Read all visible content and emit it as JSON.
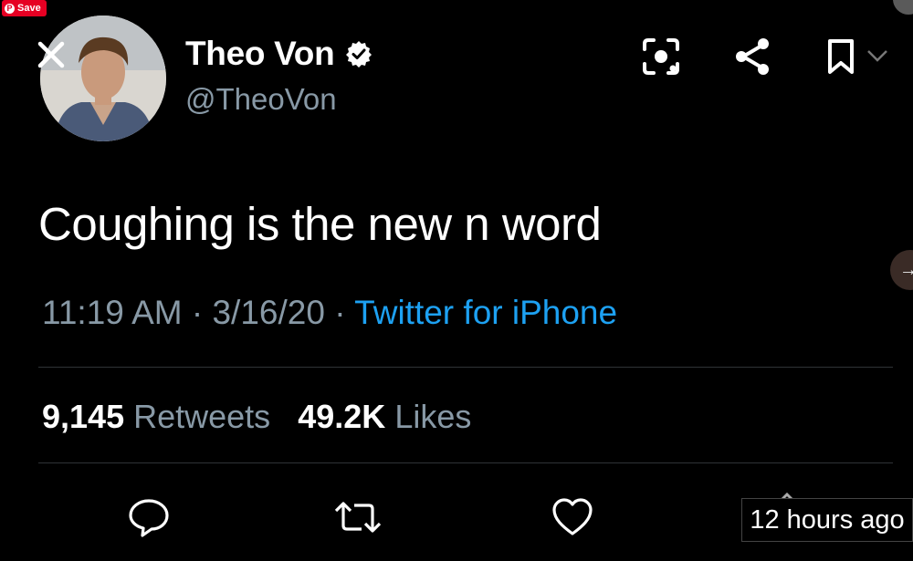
{
  "pinterest": {
    "save_label": "Save"
  },
  "author": {
    "name": "Theo Von",
    "handle": "@TheoVon",
    "verified": true
  },
  "tweet": {
    "text": "Coughing is the new n word",
    "time": "11:19 AM",
    "date": "3/16/20",
    "separator": "·",
    "source": "Twitter for iPhone"
  },
  "stats": {
    "retweets_count": "9,145",
    "retweets_label": "Retweets",
    "likes_count": "49.2K",
    "likes_label": "Likes"
  },
  "overlay": {
    "timestamp": "12 hours ago"
  },
  "icons": {
    "close": "close-icon",
    "lens": "lens-icon",
    "share": "share-icon",
    "bookmark": "bookmark-icon",
    "reply": "reply-icon",
    "retweet": "retweet-icon",
    "like": "heart-icon",
    "upload": "upload-icon"
  },
  "colors": {
    "background": "#000000",
    "secondary_text": "#8899a6",
    "link": "#1da1f2",
    "pinterest_red": "#e60023"
  }
}
